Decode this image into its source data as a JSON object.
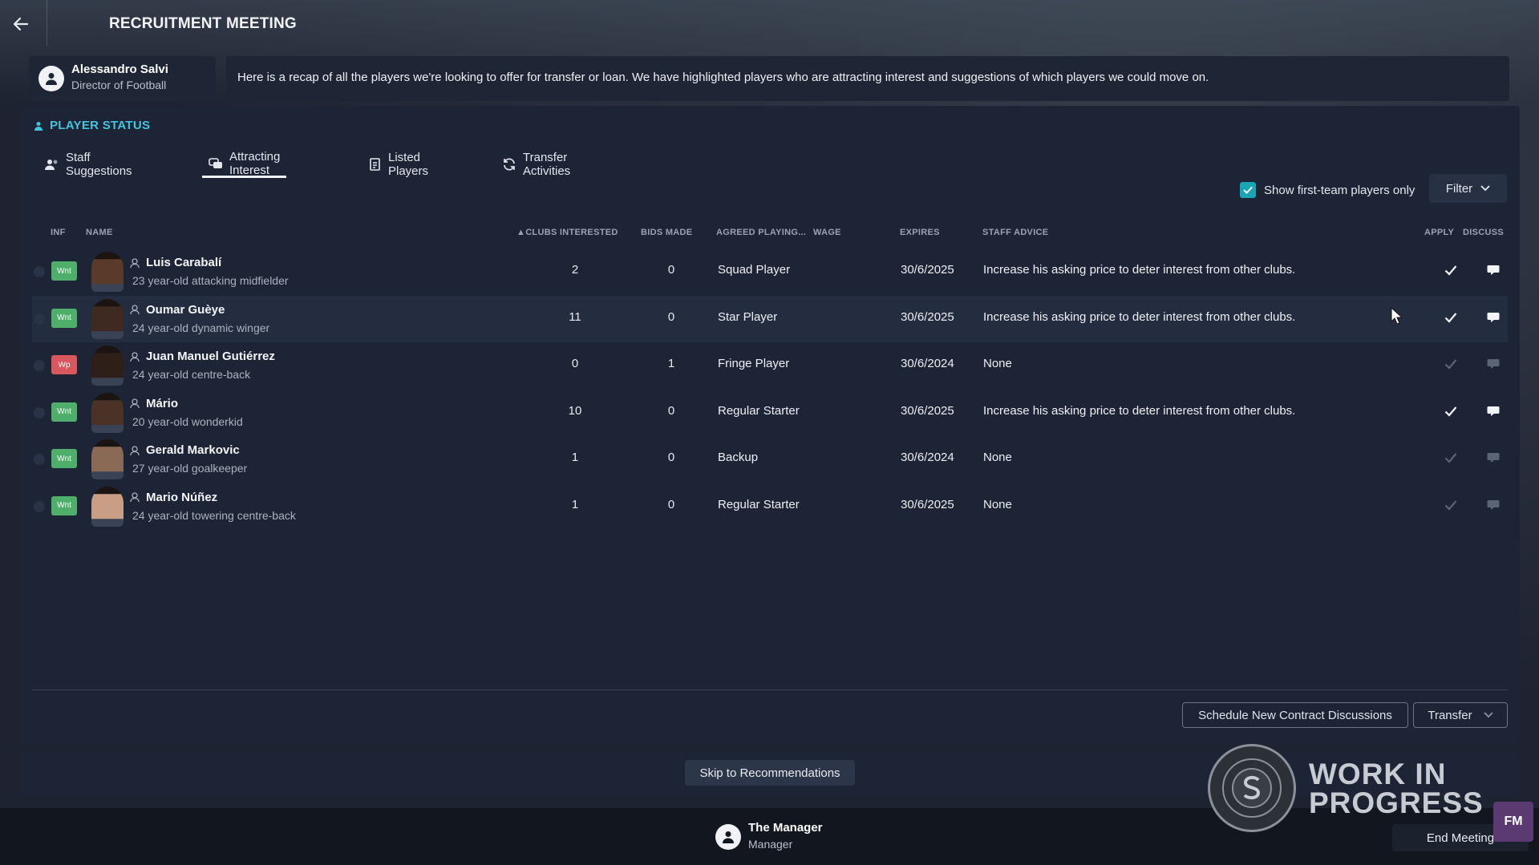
{
  "header": {
    "title": "RECRUITMENT MEETING"
  },
  "speaker": {
    "name": "Alessandro Salvi",
    "role": "Director of Football",
    "message": "Here is a recap of all the players we're looking to offer for transfer or loan. We have highlighted players who are attracting interest and suggestions of which players we could move on."
  },
  "panel": {
    "title": "PLAYER STATUS",
    "tabs": [
      {
        "label": "Staff Suggestions",
        "icon": "staff-icon",
        "active": false
      },
      {
        "label": "Attracting Interest",
        "icon": "interest-icon",
        "active": true
      },
      {
        "label": "Listed Players",
        "icon": "list-icon",
        "active": false
      },
      {
        "label": "Transfer Activities",
        "icon": "refresh-icon",
        "active": false
      }
    ],
    "first_team_only": {
      "label": "Show first-team players only",
      "checked": true
    },
    "filter_label": "Filter"
  },
  "table": {
    "columns": {
      "inf": "INF",
      "name": "NAME",
      "clubs": "CLUBS INTERESTED",
      "bids": "BIDS MADE",
      "agreed": "AGREED PLAYING...",
      "wage": "WAGE",
      "expires": "EXPIRES",
      "advice": "STAFF ADVICE",
      "apply": "APPLY",
      "discuss": "DISCUSS"
    },
    "sort_column": "CLUBS INTERESTED",
    "rows": [
      {
        "inf": "Wnt",
        "name": "Luis Carabalí",
        "desc": "23 year-old attacking midfielder",
        "clubs": "2",
        "bids": "0",
        "agreed": "Squad Player",
        "expires": "30/6/2025",
        "advice": "Increase his asking price to deter interest from other clubs.",
        "actions_enabled": true
      },
      {
        "inf": "Wnt",
        "name": "Oumar Guèye",
        "desc": "24 year-old dynamic winger",
        "clubs": "11",
        "bids": "0",
        "agreed": "Star Player",
        "expires": "30/6/2025",
        "advice": "Increase his asking price to deter interest from other clubs.",
        "actions_enabled": true
      },
      {
        "inf": "Wp",
        "name": "Juan Manuel Gutiérrez",
        "desc": "24 year-old centre-back",
        "clubs": "0",
        "bids": "1",
        "agreed": "Fringe Player",
        "expires": "30/6/2024",
        "advice": "None",
        "actions_enabled": false
      },
      {
        "inf": "Wnt",
        "name": "Mário",
        "desc": "20 year-old wonderkid",
        "clubs": "10",
        "bids": "0",
        "agreed": "Regular Starter",
        "expires": "30/6/2025",
        "advice": "Increase his asking price to deter interest from other clubs.",
        "actions_enabled": true
      },
      {
        "inf": "Wnt",
        "name": "Gerald Markovic",
        "desc": "27 year-old goalkeeper",
        "clubs": "1",
        "bids": "0",
        "agreed": "Backup",
        "expires": "30/6/2024",
        "advice": "None",
        "actions_enabled": false
      },
      {
        "inf": "Wnt",
        "name": "Mario Núñez",
        "desc": "24 year-old towering centre-back",
        "clubs": "1",
        "bids": "0",
        "agreed": "Regular Starter",
        "expires": "30/6/2025",
        "advice": "None",
        "actions_enabled": false
      }
    ]
  },
  "footer_actions": {
    "schedule": "Schedule New Contract Discussions",
    "transfer": "Transfer"
  },
  "skip_label": "Skip to Recommendations",
  "manager": {
    "name": "The Manager",
    "role": "Manager"
  },
  "end_meeting": "End Meeting",
  "watermark": {
    "line1": "WORK IN",
    "line2": "PROGRESS",
    "badge": "FM"
  },
  "colors": {
    "accent": "#3fc6de",
    "wanted": "#4fae6a",
    "wp": "#d9585d",
    "checkbox": "#1aa5b4"
  }
}
